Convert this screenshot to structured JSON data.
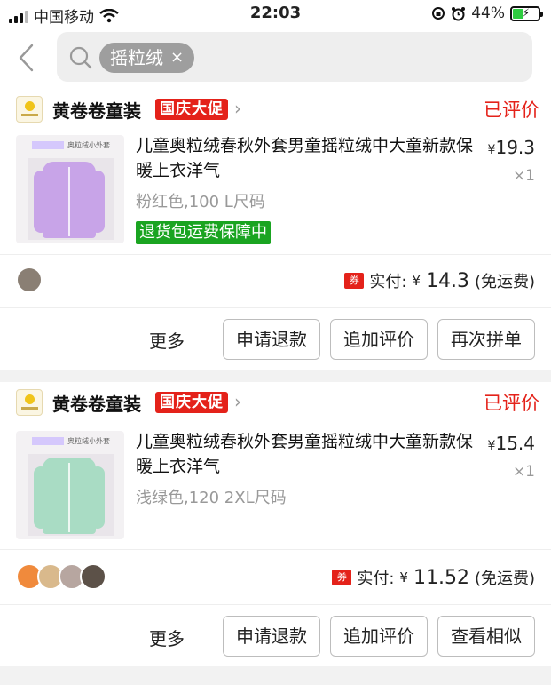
{
  "status_bar": {
    "carrier": "中国移动",
    "time": "22:03",
    "battery": "44%"
  },
  "search": {
    "tag": "摇粒绒",
    "tag_close": "×"
  },
  "orders": [
    {
      "shop_name": "黄卷卷童装",
      "promo_badge": "国庆大促",
      "status": "已评价",
      "thumb_caption": "奥粒绒小外套",
      "thumb_color": "#c8a4e8",
      "title": "儿童奥粒绒春秋外套男童摇粒绒中大童新款保暖上衣洋气",
      "price": "19.3",
      "quantity": "×1",
      "spec": "粉红色,100 L尺码",
      "guarantee": "退货包运费保障中",
      "paid_label": "实付:",
      "paid_amount": "14.3",
      "shipping": "(免运费)",
      "coupon": "券",
      "actions": [
        "更多",
        "申请退款",
        "追加评价",
        "再次拼单"
      ]
    },
    {
      "shop_name": "黄卷卷童装",
      "promo_badge": "国庆大促",
      "status": "已评价",
      "thumb_caption": "奥粒绒小外套",
      "thumb_color": "#a9dcc4",
      "title": "儿童奥粒绒春秋外套男童摇粒绒中大童新款保暖上衣洋气",
      "price": "15.4",
      "quantity": "×1",
      "spec": "浅绿色,120 2XL尺码",
      "paid_label": "实付:",
      "paid_amount": "11.52",
      "shipping": "(免运费)",
      "coupon": "券",
      "actions": [
        "更多",
        "申请退款",
        "追加评价",
        "查看相似"
      ]
    }
  ],
  "colors": {
    "accent_red": "#e4221a",
    "guarantee_green": "#1aa421"
  },
  "icons": [
    "back-chevron-icon",
    "search-icon",
    "signal-icon",
    "wifi-icon",
    "alarm-icon",
    "battery-icon"
  ]
}
